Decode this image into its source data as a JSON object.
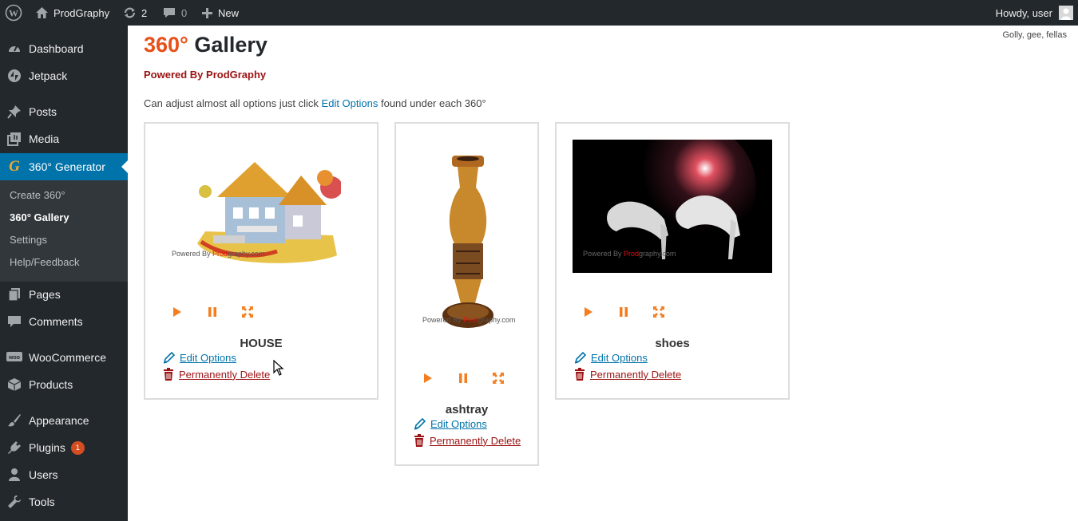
{
  "adminbar": {
    "site_name": "ProdGraphy",
    "updates_count": "2",
    "comments_count": "0",
    "new_label": "New",
    "howdy": "Howdy, user"
  },
  "sidebar": {
    "items": [
      {
        "label": "Dashboard",
        "icon": "dashboard-icon"
      },
      {
        "label": "Jetpack",
        "icon": "jetpack-icon"
      },
      {
        "label": "Posts",
        "icon": "pin-icon"
      },
      {
        "label": "Media",
        "icon": "media-icon"
      },
      {
        "label": "360° Generator",
        "icon": "generator-icon"
      },
      {
        "label": "Pages",
        "icon": "pages-icon"
      },
      {
        "label": "Comments",
        "icon": "comment-icon"
      },
      {
        "label": "WooCommerce",
        "icon": "woo-icon"
      },
      {
        "label": "Products",
        "icon": "box-icon"
      },
      {
        "label": "Appearance",
        "icon": "brush-icon"
      },
      {
        "label": "Plugins",
        "icon": "plugin-icon"
      },
      {
        "label": "Users",
        "icon": "user-icon"
      },
      {
        "label": "Tools",
        "icon": "wrench-icon"
      }
    ],
    "submenu": [
      "Create 360°",
      "360° Gallery",
      "Settings",
      "Help/Feedback"
    ],
    "plugins_badge": "1"
  },
  "content": {
    "corner_text": "Golly, gee, fellas",
    "title_accent": "360°",
    "title_rest": " Gallery",
    "powered": "Powered By ProdGraphy",
    "intro_before": "Can adjust almost all options just click ",
    "intro_link": "Edit Options",
    "intro_after": " found under each 360°"
  },
  "gallery": {
    "edit_label": "Edit Options",
    "delete_label": "Permanently Delete",
    "watermark_before": "Powered By ",
    "watermark_red": "Prod",
    "watermark_after": "graphy.com",
    "items": [
      {
        "title": "HOUSE"
      },
      {
        "title": "ashtray"
      },
      {
        "title": "shoes"
      }
    ]
  }
}
